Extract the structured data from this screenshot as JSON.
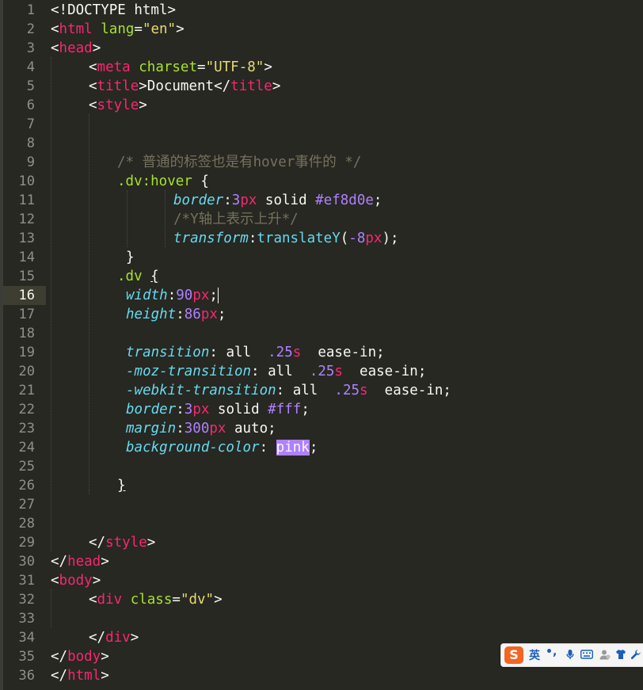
{
  "gutter": {
    "line_numbers": [
      "1",
      "2",
      "3",
      "4",
      "5",
      "6",
      "7",
      "8",
      "9",
      "10",
      "11",
      "12",
      "13",
      "14",
      "15",
      "16",
      "17",
      "18",
      "19",
      "20",
      "21",
      "22",
      "23",
      "24",
      "25",
      "26",
      "27",
      "28",
      "29",
      "30",
      "31",
      "32",
      "33",
      "34",
      "35",
      "36"
    ],
    "current_line": "16"
  },
  "code": {
    "l1": {
      "decl": "<!DOCTYPE html>"
    },
    "l2": {
      "lt": "<",
      "tag": "html",
      "attr": "lang",
      "eq": "=",
      "val": "\"en\"",
      "gt": ">"
    },
    "l3": {
      "lt": "<",
      "tag": "head",
      "gt": ">"
    },
    "l4": {
      "lt": "<",
      "tag": "meta",
      "attr": "charset",
      "eq": "=",
      "val": "\"UTF-8\"",
      "gt": ">"
    },
    "l5": {
      "lt": "<",
      "tag": "title",
      "gt": ">",
      "text": "Document",
      "lt2": "</",
      "tag2": "title",
      "gt2": ">"
    },
    "l6": {
      "lt": "<",
      "tag": "style",
      "gt": ">"
    },
    "l9": {
      "comment": "/* 普通的标签也是有hover事件的 */"
    },
    "l10": {
      "selector": ".dv:hover",
      "brace": " {"
    },
    "l11": {
      "prop": "border",
      "colon": ":",
      "num": "3",
      "unit": "px",
      "rest1": " solid ",
      "val": "#ef8d0e",
      "semi": ";"
    },
    "l12": {
      "comment": "/*Y轴上表示上升*/"
    },
    "l13": {
      "prop": "transform",
      "colon": ":",
      "fn": "translateY",
      "op": "(",
      "num": "-8",
      "unit": "px",
      "cp": ");"
    },
    "l14": {
      "brace": "}"
    },
    "l15": {
      "selector": ".dv",
      "sp": " ",
      "brace": "{"
    },
    "l16": {
      "prop": "width",
      "colon": ":",
      "num": "90",
      "unit": "px",
      "semi": ";"
    },
    "l17": {
      "prop": "height",
      "colon": ":",
      "num": "86",
      "unit": "px",
      "semi": ";"
    },
    "l19": {
      "prop": "transition",
      "colon": ": ",
      "v1": "all",
      "sp1": "  ",
      "num": ".25",
      "unit": "s",
      "sp2": "  ",
      "v2": "ease-in",
      "semi": ";"
    },
    "l20": {
      "prop": "-moz-transition",
      "colon": ": ",
      "v1": "all",
      "sp1": "  ",
      "num": ".25",
      "unit": "s",
      "sp2": "  ",
      "v2": "ease-in",
      "semi": ";"
    },
    "l21": {
      "prop": "-webkit-transition",
      "colon": ": ",
      "v1": "all",
      "sp1": "  ",
      "num": ".25",
      "unit": "s",
      "sp2": "  ",
      "v2": "ease-in",
      "semi": ";"
    },
    "l22": {
      "prop": "border",
      "colon": ":",
      "num": "3",
      "unit": "px",
      "rest1": " solid ",
      "val": "#fff",
      "semi": ";"
    },
    "l23": {
      "prop": "margin",
      "colon": ":",
      "num": "300",
      "unit": "px",
      "rest1": " auto",
      "semi": ";"
    },
    "l24": {
      "prop": "background-color",
      "colon": ": ",
      "val": "pink",
      "semi": ";"
    },
    "l26": {
      "brace": "}"
    },
    "l29": {
      "lt": "</",
      "tag": "style",
      "gt": ">"
    },
    "l30": {
      "lt": "</",
      "tag": "head",
      "gt": ">"
    },
    "l31": {
      "lt": "<",
      "tag": "body",
      "gt": ">"
    },
    "l32": {
      "lt": "<",
      "tag": "div",
      "attr": "class",
      "eq": "=",
      "val": "\"dv\"",
      "gt": ">"
    },
    "l34": {
      "lt": "</",
      "tag": "div",
      "gt": ">"
    },
    "l35": {
      "lt": "</",
      "tag": "body",
      "gt": ">"
    },
    "l36": {
      "lt": "</",
      "tag": "html",
      "gt": ">"
    }
  },
  "ime_toolbar": {
    "logo_icon": "sogou-s-icon",
    "logo_letter": "S",
    "language": "英",
    "punctuation": "•,",
    "icons": [
      "microphone-icon",
      "keyboard-icon",
      "user-icon",
      "shirt-icon",
      "wrench-icon"
    ]
  },
  "colors": {
    "background": "#272822",
    "tag": "#f92672",
    "attribute": "#a6e22e",
    "string": "#e6db74",
    "comment": "#75715e",
    "property": "#66d9ef",
    "number": "#ae81ff",
    "selection": "#ae81ff"
  }
}
